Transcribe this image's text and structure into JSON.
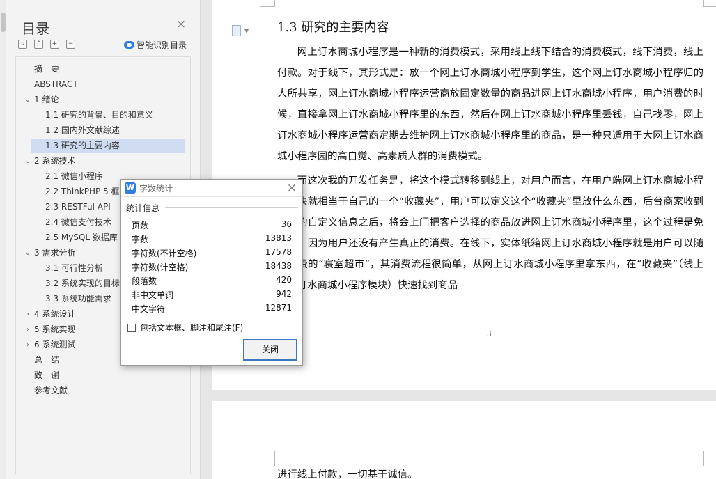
{
  "nav": {
    "title": "目录",
    "smart_toc_label": "智能识别目录",
    "tool_icons": [
      "collapse-all-icon",
      "expand-all-icon",
      "add-heading-icon",
      "remove-heading-icon"
    ],
    "items": [
      {
        "label": "摘　要",
        "level": 1,
        "chevron": ""
      },
      {
        "label": "ABSTRACT",
        "level": 1,
        "chevron": ""
      },
      {
        "label": "1 绪论",
        "level": 1,
        "chevron": "⌄"
      },
      {
        "label": "1.1  研究的背景、目的和意义",
        "level": 2,
        "chevron": ""
      },
      {
        "label": "1.2  国内外文献综述",
        "level": 2,
        "chevron": ""
      },
      {
        "label": "1.3  研究的主要内容",
        "level": 2,
        "chevron": "",
        "active": true
      },
      {
        "label": "2 系统技术",
        "level": 1,
        "chevron": "⌄"
      },
      {
        "label": "2.1  微信小程序",
        "level": 2,
        "chevron": ""
      },
      {
        "label": "2.2 ThinkPHP 5  框架",
        "level": 2,
        "chevron": ""
      },
      {
        "label": "2.3 RESTFul API",
        "level": 2,
        "chevron": ""
      },
      {
        "label": "2.4  微信支付技术",
        "level": 2,
        "chevron": ""
      },
      {
        "label": "2.5 MySQL 数据库",
        "level": 2,
        "chevron": ""
      },
      {
        "label": "3 需求分析",
        "level": 1,
        "chevron": "⌄"
      },
      {
        "label": "3.1 可行性分析",
        "level": 2,
        "chevron": ""
      },
      {
        "label": "3.2 系统实现的目标",
        "level": 2,
        "chevron": ""
      },
      {
        "label": "3.3 系统功能需求",
        "level": 2,
        "chevron": ""
      },
      {
        "label": "4 系统设计",
        "level": 1,
        "chevron": "›"
      },
      {
        "label": "5 系统实现",
        "level": 1,
        "chevron": "›"
      },
      {
        "label": "6 系统测试",
        "level": 1,
        "chevron": "›"
      },
      {
        "label": "总　结",
        "level": 1,
        "chevron": ""
      },
      {
        "label": "致　谢",
        "level": 1,
        "chevron": ""
      },
      {
        "label": "参考文献",
        "level": 1,
        "chevron": ""
      }
    ]
  },
  "document": {
    "heading": "1.3  研究的主要内容",
    "paragraphs": [
      "网上订水商城小程序是一种新的消费模式，采用线上线下结合的消费模式，线下消费，线上付款。对于线下，其形式是：放一个网上订水商城小程序到学生，这个网上订水商城小程序归的人所共享，网上订水商城小程序运营商放固定数量的商品进网上订水商城小程序，用户消费的时候，直接拿网上订水商城小程序里的东西，然后在网上订水商城小程序里丢钱，自己找零，网上订水商城小程序运营商定期去维护网上订水商城小程序里的商品，是一种只适用于大网上订水商城小程序园的高自觉、高素质人群的消费模式。",
      "而这次我的开发任务是，将这个模式转移到线上，对用户而言，在用户端网上订水商城小程序模块就相当于自己的一个“收藏夹”，用户可以定义这个“收藏夹”里放什么东西，后台商家收到用户的自定义信息之后，将会上门把客户选择的商品放进网上订水商城小程序里，这个过程是免费的，因为用户还没有产生真正的消费。在线下，实体纸箱网上订水商城小程序就是用户可以随时消费的“寝室超市”，其消费流程很简单，从网上订水商城小程序里拿东西，在“收藏夹”（线上网上订水商城小程序模块）快速找到商品"
    ],
    "page_number": "3",
    "next_page_text": "进行线上付款，一切基于诚信。"
  },
  "dialog": {
    "title": "字数统计",
    "section_label": "统计信息",
    "stats": [
      {
        "label": "页数",
        "value": "36"
      },
      {
        "label": "字数",
        "value": "13813"
      },
      {
        "label": "字符数(不计空格)",
        "value": "17578"
      },
      {
        "label": "字符数(计空格)",
        "value": "18438"
      },
      {
        "label": "段落数",
        "value": "420"
      },
      {
        "label": "非中文单词",
        "value": "942"
      },
      {
        "label": "中文字符",
        "value": "12871"
      }
    ],
    "checkbox_label": "包括文本框、脚注和尾注(F)",
    "checkbox_checked": false,
    "close_button": "关闭"
  },
  "colors": {
    "accent": "#2f7de1",
    "active_toc_bg": "#cfdcf2",
    "dialog_button_border": "#3b78c4"
  }
}
